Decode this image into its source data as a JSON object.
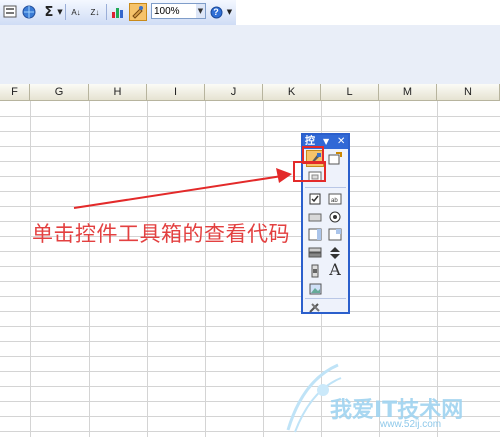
{
  "toolbar": {
    "sigma": "Σ",
    "sort_asc": "A↓",
    "sort_desc": "Z↓",
    "zoom": "100%",
    "help": "?"
  },
  "columns": [
    "F",
    "G",
    "H",
    "I",
    "J",
    "K",
    "L",
    "M",
    "N"
  ],
  "toolbox": {
    "title": "控",
    "label_tool": "A"
  },
  "caption": "单击控件工具箱的查看代码",
  "watermark": {
    "text": "我爱IT技术网",
    "url": "www.52ij.com"
  },
  "colors": {
    "annotation_red": "#e32a2a",
    "toolbox_blue": "#3169d6"
  }
}
